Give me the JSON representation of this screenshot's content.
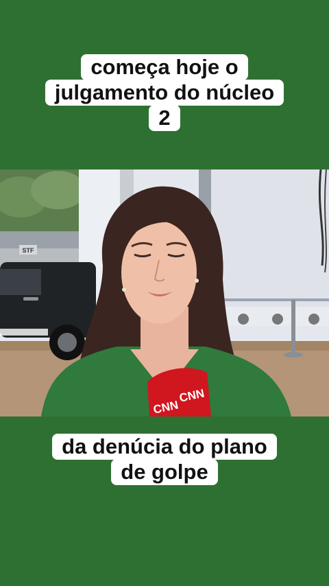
{
  "caption_top": {
    "lines": [
      "começa hoje o",
      "julgamento do núcleo",
      "2"
    ]
  },
  "caption_bottom": {
    "lines": [
      "da denúcia do plano",
      "de golpe"
    ]
  },
  "video": {
    "building_sign": "STF",
    "mic_logos": [
      "CNN",
      "CNN"
    ]
  },
  "colors": {
    "background": "#2e7031",
    "caption_bg": "#ffffff",
    "caption_text": "#111111",
    "mic_red": "#d0161f"
  }
}
